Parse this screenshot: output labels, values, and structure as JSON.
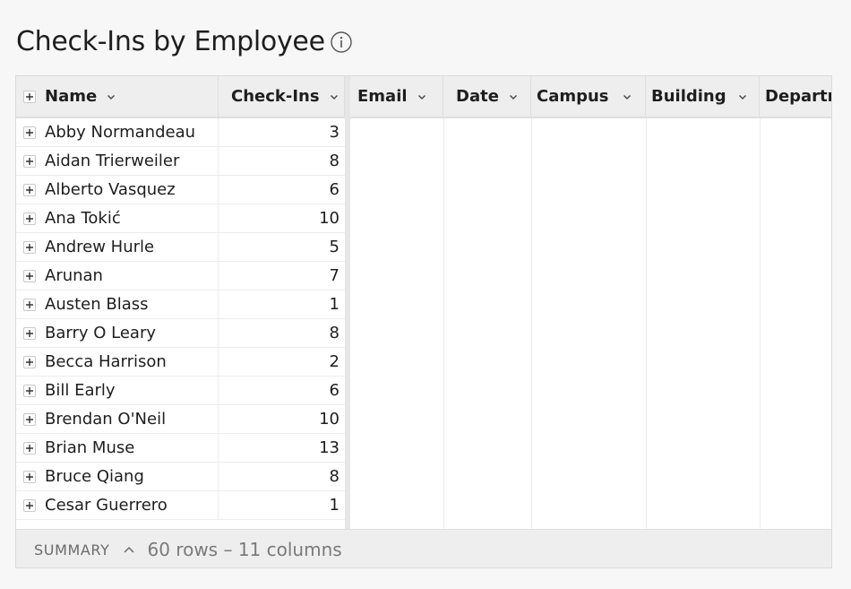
{
  "page": {
    "title": "Check-Ins by Employee"
  },
  "table": {
    "columns": [
      {
        "key": "name",
        "label": "Name"
      },
      {
        "key": "checkins",
        "label": "Check-Ins"
      },
      {
        "key": "email",
        "label": "Email"
      },
      {
        "key": "date",
        "label": "Date"
      },
      {
        "key": "campus",
        "label": "Campus"
      },
      {
        "key": "building",
        "label": "Building"
      },
      {
        "key": "department",
        "label": "Departm"
      }
    ],
    "rows": [
      {
        "name": "Abby Normandeau",
        "checkins": "3"
      },
      {
        "name": "Aidan Trierweiler",
        "checkins": "8"
      },
      {
        "name": "Alberto Vasquez",
        "checkins": "6"
      },
      {
        "name": "Ana Tokić",
        "checkins": "10"
      },
      {
        "name": "Andrew Hurle",
        "checkins": "5"
      },
      {
        "name": "Arunan",
        "checkins": "7"
      },
      {
        "name": "Austen Blass",
        "checkins": "1"
      },
      {
        "name": "Barry O Leary",
        "checkins": "8"
      },
      {
        "name": "Becca Harrison",
        "checkins": "2"
      },
      {
        "name": "Bill Early",
        "checkins": "6"
      },
      {
        "name": "Brendan O'Neil",
        "checkins": "10"
      },
      {
        "name": "Brian Muse",
        "checkins": "13"
      },
      {
        "name": "Bruce Qiang",
        "checkins": "8"
      },
      {
        "name": "Cesar Guerrero",
        "checkins": "1"
      }
    ]
  },
  "summary": {
    "label": "SUMMARY",
    "info": "60 rows – 11 columns"
  },
  "icons": {
    "info": "info-icon",
    "expand": "plus-icon",
    "sort": "chevron-down-icon",
    "summary_toggle": "chevron-up-icon"
  },
  "colors": {
    "background": "#f7f7f8",
    "header": "#eeeeee",
    "text": "#1e1e1e",
    "muted": "#7a7a7a"
  }
}
